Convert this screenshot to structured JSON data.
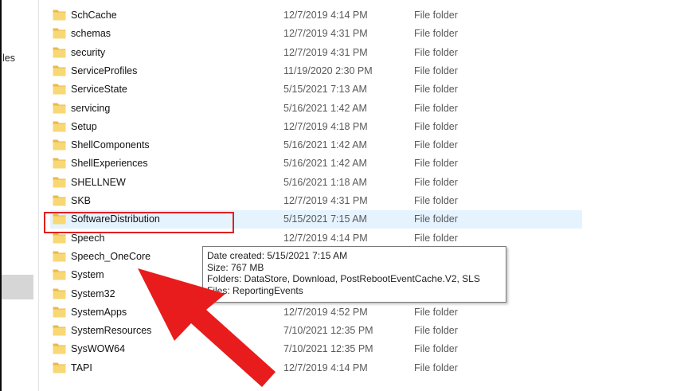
{
  "nav": {
    "partial_label": "les"
  },
  "files": [
    {
      "name": "SchCache",
      "date": "12/7/2019 4:14 PM",
      "type": "File folder"
    },
    {
      "name": "schemas",
      "date": "12/7/2019 4:31 PM",
      "type": "File folder"
    },
    {
      "name": "security",
      "date": "12/7/2019 4:31 PM",
      "type": "File folder"
    },
    {
      "name": "ServiceProfiles",
      "date": "11/19/2020 2:30 PM",
      "type": "File folder"
    },
    {
      "name": "ServiceState",
      "date": "5/15/2021 7:13 AM",
      "type": "File folder"
    },
    {
      "name": "servicing",
      "date": "5/16/2021 1:42 AM",
      "type": "File folder"
    },
    {
      "name": "Setup",
      "date": "12/7/2019 4:18 PM",
      "type": "File folder"
    },
    {
      "name": "ShellComponents",
      "date": "5/16/2021 1:42 AM",
      "type": "File folder"
    },
    {
      "name": "ShellExperiences",
      "date": "5/16/2021 1:42 AM",
      "type": "File folder"
    },
    {
      "name": "SHELLNEW",
      "date": "5/16/2021 1:18 AM",
      "type": "File folder"
    },
    {
      "name": "SKB",
      "date": "12/7/2019 4:31 PM",
      "type": "File folder"
    },
    {
      "name": "SoftwareDistribution",
      "date": "5/15/2021 7:15 AM",
      "type": "File folder",
      "selected": true
    },
    {
      "name": "Speech",
      "date": "12/7/2019 4:14 PM",
      "type": "File folder"
    },
    {
      "name": "Speech_OneCore",
      "date": "",
      "type": ""
    },
    {
      "name": "System",
      "date": "",
      "type": ""
    },
    {
      "name": "System32",
      "date": "",
      "type": ""
    },
    {
      "name": "SystemApps",
      "date": "12/7/2019 4:52 PM",
      "type": "File folder"
    },
    {
      "name": "SystemResources",
      "date": "7/10/2021 12:35 PM",
      "type": "File folder"
    },
    {
      "name": "SysWOW64",
      "date": "7/10/2021 12:35 PM",
      "type": "File folder"
    },
    {
      "name": "TAPI",
      "date": "12/7/2019 4:14 PM",
      "type": "File folder"
    }
  ],
  "tooltip": {
    "date_created": "Date created: 5/15/2021 7:15 AM",
    "size": "Size: 767 MB",
    "folders": "Folders: DataStore, Download, PostRebootEventCache.V2, SLS",
    "files": "Files: ReportingEvents"
  },
  "colors": {
    "selection": "#e5f3ff",
    "highlight": "#e02020",
    "folder": "#f8d775",
    "arrow": "#e81c1c"
  }
}
